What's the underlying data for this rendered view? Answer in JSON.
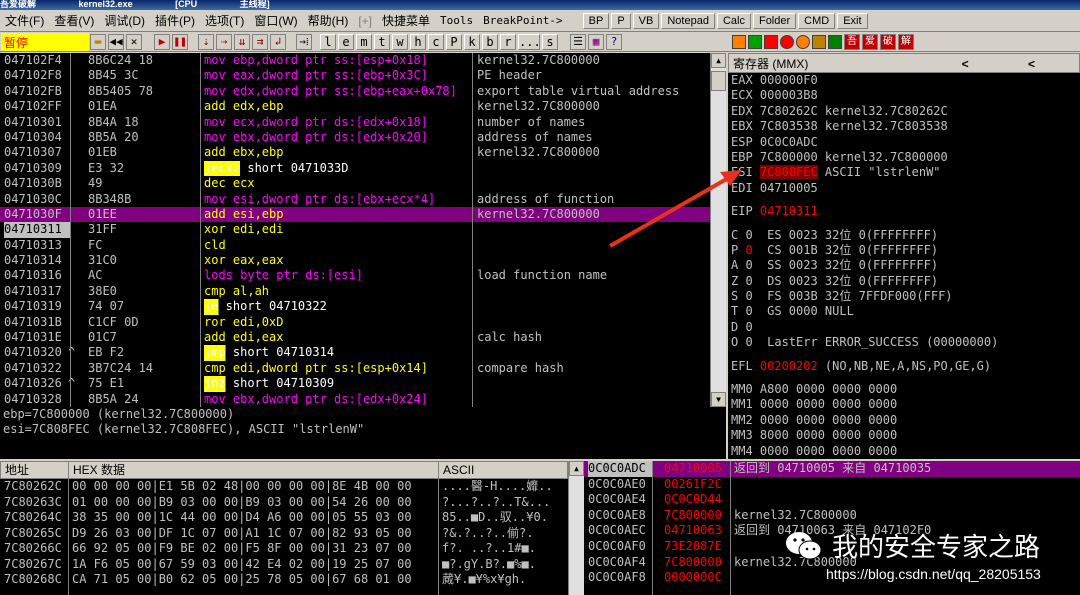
{
  "window": {
    "title_parts": [
      "吾爱破解",
      "kernel32.exe",
      "[CPU",
      "主线程]"
    ]
  },
  "menubar": {
    "items": [
      "文件(F)",
      "查看(V)",
      "调试(D)",
      "插件(P)",
      "选项(T)",
      "窗口(W)",
      "帮助(H)",
      "[+]",
      "快捷菜单",
      "Tools",
      "BreakPoint->"
    ],
    "buttons": [
      "BP",
      "P",
      "VB",
      "Notepad",
      "Calc",
      "Folder",
      "CMD",
      "Exit"
    ]
  },
  "toolbar": {
    "status": "暂停",
    "letters": [
      "l",
      "e",
      "m",
      "t",
      "w",
      "h",
      "c",
      "P",
      "k",
      "b",
      "r",
      "...",
      "s"
    ],
    "colors": [
      "#ff8000",
      "#00a000",
      "#ff0000",
      "#ff0000",
      "#ff8000",
      "#c08000",
      "#008000",
      "#ff00ff",
      "#800000",
      "#c00000",
      "#c00000"
    ],
    "plugin_glyphs": [
      "吾",
      "爱",
      "破",
      "解"
    ]
  },
  "disasm": {
    "rows": [
      {
        "addr": "047102F4",
        "hex": "8B6C24 18",
        "instr": "mov ebp,dword ptr ss:[esp+0x18]",
        "comment": "kernel32.7C800000"
      },
      {
        "addr": "047102F8",
        "hex": "8B45 3C",
        "instr": "mov eax,dword ptr ss:[ebp+0x3C]",
        "comment": "PE header"
      },
      {
        "addr": "047102FB",
        "hex": "8B5405 78",
        "instr": "mov edx,dword ptr ss:[ebp+eax+0x78]",
        "comment": "export table virtual address"
      },
      {
        "addr": "047102FF",
        "hex": "01EA",
        "instr": "add edx,ebp",
        "comment": "kernel32.7C800000"
      },
      {
        "addr": "04710301",
        "hex": "8B4A 18",
        "instr": "mov ecx,dword ptr ds:[edx+0x18]",
        "comment": "number of names"
      },
      {
        "addr": "04710304",
        "hex": "8B5A 20",
        "instr": "mov ebx,dword ptr ds:[edx+0x20]",
        "comment": "address of names"
      },
      {
        "addr": "04710307",
        "hex": "01EB",
        "instr": "add ebx,ebp",
        "comment": "kernel32.7C800000"
      },
      {
        "addr": "04710309",
        "hex": "E3 32",
        "instr": "jecxz short 0471033D",
        "comment": ""
      },
      {
        "addr": "0471030B",
        "hex": "49",
        "instr": "dec ecx",
        "comment": ""
      },
      {
        "addr": "0471030C",
        "hex": "8B348B",
        "instr": "mov esi,dword ptr ds:[ebx+ecx*4]",
        "comment": "address of function"
      },
      {
        "addr": "0471030F",
        "hex": "01EE",
        "instr": "add esi,ebp",
        "comment": "kernel32.7C800000"
      },
      {
        "addr": "04710311",
        "hex": "31FF",
        "instr": "xor edi,edi",
        "comment": ""
      },
      {
        "addr": "04710313",
        "hex": "FC",
        "instr": "cld",
        "comment": ""
      },
      {
        "addr": "04710314",
        "hex": "31C0",
        "instr": "xor eax,eax",
        "comment": ""
      },
      {
        "addr": "04710316",
        "hex": "AC",
        "instr": "lods byte ptr ds:[esi]",
        "comment": "load function name"
      },
      {
        "addr": "04710317",
        "hex": "38E0",
        "instr": "cmp al,ah",
        "comment": ""
      },
      {
        "addr": "04710319",
        "hex": "74 07",
        "instr": "je short 04710322",
        "comment": ""
      },
      {
        "addr": "0471031B",
        "hex": "C1CF 0D",
        "instr": "ror edi,0xD",
        "comment": ""
      },
      {
        "addr": "0471031E",
        "hex": "01C7",
        "instr": "add edi,eax",
        "comment": "calc hash"
      },
      {
        "addr": "04710320",
        "hex": "EB F2",
        "instr": "jmp short 04710314",
        "comment": ""
      },
      {
        "addr": "04710322",
        "hex": "3B7C24 14",
        "instr": "cmp edi,dword ptr ss:[esp+0x14]",
        "comment": "compare hash"
      },
      {
        "addr": "04710326",
        "hex": "75 E1",
        "instr": "jnz short 04710309",
        "comment": ""
      },
      {
        "addr": "04710328",
        "hex": "8B5A 24",
        "instr": "mov ebx,dword ptr ds:[edx+0x24]",
        "comment": ""
      }
    ],
    "selected_index": 10,
    "current_index": 11,
    "jump_markers": {
      "19": "^",
      "21": "^"
    }
  },
  "info": {
    "line1": "ebp=7C800000 (kernel32.7C800000)",
    "line2": "esi=7C808FEC (kernel32.7C808FEC), ASCII \"lstrlenW\""
  },
  "registers": {
    "header": "寄存器 (MMX)",
    "nav": "< <",
    "lines": [
      [
        "EAX 000000F0"
      ],
      [
        "ECX 000003B8"
      ],
      [
        "EDX 7C80262C kernel32.7C80262C"
      ],
      [
        "EBX 7C803538 kernel32.7C803538"
      ],
      [
        "ESP 0C0C0ADC"
      ],
      [
        "EBP 7C800000 kernel32.7C800000"
      ],
      [
        "ESI ",
        "7C808FEC",
        " ASCII \"lstrlenW\""
      ],
      [
        "EDI 04710005"
      ],
      [
        ""
      ],
      [
        "EIP ",
        "04710311"
      ],
      [
        ""
      ],
      [
        "C 0  ES 0023 32位 0(FFFFFFFF)"
      ],
      [
        "P ",
        "0",
        "  CS 001B 32位 0(FFFFFFFF)"
      ],
      [
        "A 0  SS 0023 32位 0(FFFFFFFF)"
      ],
      [
        "Z 0  DS 0023 32位 0(FFFFFFFF)"
      ],
      [
        "S 0  FS 003B 32位 7FFDF000(FFF)"
      ],
      [
        "T 0  GS 0000 NULL"
      ],
      [
        "D 0"
      ],
      [
        "O 0  LastErr ERROR_SUCCESS (00000000)"
      ],
      [
        ""
      ],
      [
        "EFL ",
        "00200202",
        " (NO,NB,NE,A,NS,PO,GE,G)"
      ],
      [
        ""
      ],
      [
        "MM0 A800 0000 0000 0000"
      ],
      [
        "MM1 0000 0000 0000 0000"
      ],
      [
        "MM2 0000 0000 0000 0000"
      ],
      [
        "MM3 8000 0000 0000 0000"
      ],
      [
        "MM4 0000 0000 0000 0000"
      ]
    ]
  },
  "hexdump": {
    "headers": {
      "addr": "地址",
      "hex": "HEX 数据",
      "ascii": "ASCII"
    },
    "rows": [
      {
        "addr": "7C80262C",
        "data": "00 00 00 00|E1 5B 02 48|00 00 00 00|8E 4B 00 00",
        "ascii": "....醫-H....孊.."
      },
      {
        "addr": "7C80263C",
        "data": "01 00 00 00|B9 03 00 00|B9 03 00 00|54 26 00 00",
        "ascii": "?...?..?..T&..."
      },
      {
        "addr": "7C80264C",
        "data": "38 35 00 00|1C 44 00 00|D4 A6 00 00|05 55 03 00",
        "ascii": "85..■D..驭..¥0."
      },
      {
        "addr": "7C80265C",
        "data": "D9 26 03 00|DF 1C 07 00|A1 1C 07 00|82 93 05 00",
        "ascii": "?&.?..?..偂?."
      },
      {
        "addr": "7C80266C",
        "data": "66 92 05 00|F9 BE 02 00|F5 8F 00 00|31 23 07 00",
        "ascii": "f?.  ..?..1#■."
      },
      {
        "addr": "7C80267C",
        "data": "1A F6 05 00|67 59 03 00|42 E4 02 00|19 25 07 00",
        "ascii": "■?.gY.B?.■%■."
      },
      {
        "addr": "7C80268C",
        "data": "CA 71 05 00|B0 62 05 00|25 78 05 00|67 68 01 00",
        "ascii": "蕆¥.■¥%x¥gh."
      }
    ]
  },
  "stack": {
    "rows": [
      {
        "addr": "0C0C0ADC",
        "val": "04710005",
        "comment": "返回到 04710005 来自 04710035"
      },
      {
        "addr": "0C0C0AE0",
        "val": "00261F2C",
        "comment": ""
      },
      {
        "addr": "0C0C0AE4",
        "val": "0C0C0D44",
        "comment": ""
      },
      {
        "addr": "0C0C0AE8",
        "val": "7C800000",
        "comment": "kernel32.7C800000"
      },
      {
        "addr": "0C0C0AEC",
        "val": "04710063",
        "comment": "返回到 04710063 来自 047102F0"
      },
      {
        "addr": "0C0C0AF0",
        "val": "73E2087E",
        "comment": ""
      },
      {
        "addr": "0C0C0AF4",
        "val": "7C800000",
        "comment": "kernel32.7C800000"
      },
      {
        "addr": "0C0C0AF8",
        "val": "0000000C",
        "comment": ""
      }
    ]
  },
  "watermark": {
    "text": "我的安全专家之路",
    "url": "https://blog.csdn.net/qq_28205153"
  }
}
